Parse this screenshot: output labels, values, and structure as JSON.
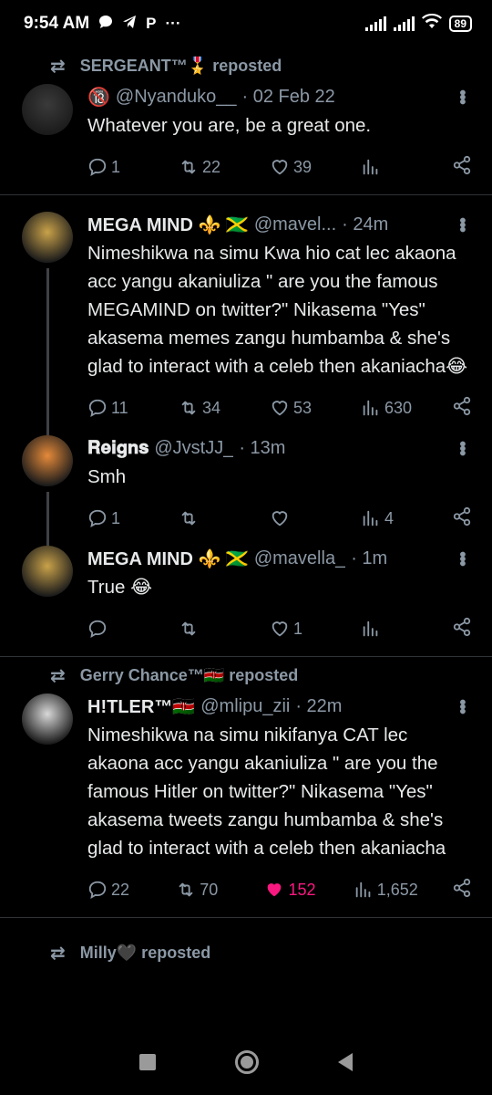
{
  "status_bar": {
    "time": "9:54 AM",
    "left_icons": [
      "chat-bubble-icon",
      "telegram-icon",
      "p-icon",
      "dots"
    ],
    "battery": "89"
  },
  "feed": [
    {
      "repost_by": "SERGEANT™🎖️ reposted",
      "avatar_color": "#3a3a3a",
      "badge": "🔞",
      "name": "",
      "handle": "@Nyanduko__",
      "time": "· 02 Feb 22",
      "text": "Whatever you are, be a great one.",
      "reply": "1",
      "retweet": "22",
      "like": "39",
      "views": "",
      "liked": false,
      "thread_line": false,
      "divider": true
    },
    {
      "repost_by": "",
      "avatar_color": "#c9a24a",
      "name": "MEGA MIND ⚜️ 🇯🇲",
      "handle": "@mavel...",
      "time": "· 24m",
      "text": "Nimeshikwa na simu Kwa hio cat lec akaona acc yangu akaniuliza \" are you the famous MEGAMIND on twitter?\" Nikasema \"Yes\" akasema memes zangu humbamba & she's glad to interact with a celeb then akaniacha😂",
      "reply": "11",
      "retweet": "34",
      "like": "53",
      "views": "630",
      "liked": false,
      "thread_line": true,
      "divider": false
    },
    {
      "repost_by": "",
      "avatar_color": "#e58a3a",
      "name": "𝐑𝐞𝐢𝐠𝐧𝐬",
      "handle": "@JvstJJ_",
      "time": "· 13m",
      "text": "Smh",
      "reply": "1",
      "retweet": "",
      "like": "",
      "views": "4",
      "liked": false,
      "thread_line": true,
      "divider": false
    },
    {
      "repost_by": "",
      "avatar_color": "#c9a24a",
      "name": "MEGA MIND ⚜️ 🇯🇲",
      "handle": "@mavella_",
      "time": "· 1m",
      "text": "True 😂",
      "reply": "",
      "retweet": "",
      "like": "1",
      "views": "",
      "liked": false,
      "thread_line": false,
      "divider": true
    },
    {
      "repost_by": "Gerry Chance™🇰🇪 reposted",
      "avatar_color": "#d8d8d8",
      "name": "H!TLER™🇰🇪",
      "handle": "@mlipu_zii",
      "time": "· 22m",
      "text": "Nimeshikwa na simu nikifanya CAT lec akaona acc yangu akaniuliza \" are you the famous Hitler on twitter?\" Nikasema \"Yes\" akasema tweets zangu humbamba & she's glad to interact with a celeb then akaniacha",
      "reply": "22",
      "retweet": "70",
      "like": "152",
      "views": "1,652",
      "liked": true,
      "thread_line": false,
      "divider": true
    }
  ],
  "trailing_repost": "Milly🖤 reposted",
  "colors": {
    "like_active": "#f91880",
    "muted": "#8b98a5",
    "text": "#e7e9ea"
  }
}
